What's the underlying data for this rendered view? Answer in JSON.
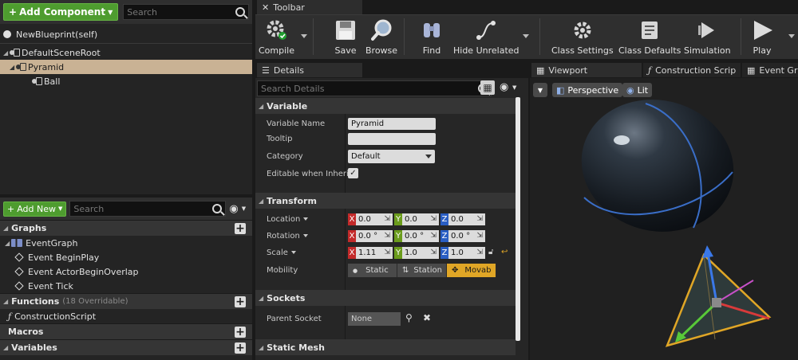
{
  "components": {
    "add_component_label": "Add Component",
    "search_placeholder": "Search",
    "self_item": "NewBlueprint(self)",
    "tree": [
      {
        "label": "DefaultSceneRoot"
      },
      {
        "label": "Pyramid"
      },
      {
        "label": "Ball"
      }
    ]
  },
  "my_blueprint": {
    "add_new_label": "Add New",
    "search_placeholder": "Search",
    "graphs_label": "Graphs",
    "event_graph_label": "EventGraph",
    "events": [
      "Event BeginPlay",
      "Event ActorBeginOverlap",
      "Event Tick"
    ],
    "functions_label": "Functions",
    "functions_sub": "(18 Overridable)",
    "construction_script_label": "ConstructionScript",
    "macros_label": "Macros",
    "variables_label": "Variables"
  },
  "toolbar": {
    "tab_label": "Toolbar",
    "buttons": {
      "compile": "Compile",
      "save": "Save",
      "browse": "Browse",
      "find": "Find",
      "hide_unrelated": "Hide Unrelated",
      "class_settings": "Class Settings",
      "class_defaults": "Class Defaults",
      "simulation": "Simulation",
      "play": "Play"
    }
  },
  "details": {
    "tab_label": "Details",
    "search_placeholder": "Search Details",
    "variable_section": "Variable",
    "variable_name_label": "Variable Name",
    "variable_name_value": "Pyramid",
    "tooltip_label": "Tooltip",
    "tooltip_value": "",
    "category_label": "Category",
    "category_value": "Default",
    "editable_label": "Editable when Inherite",
    "editable_checked": true,
    "transform_section": "Transform",
    "location_label": "Location",
    "location": {
      "x": "0.0",
      "y": "0.0",
      "z": "0.0"
    },
    "rotation_label": "Rotation",
    "rotation": {
      "x": "0.0 °",
      "y": "0.0 °",
      "z": "0.0 °"
    },
    "scale_label": "Scale",
    "scale": {
      "x": "1.11",
      "y": "1.0",
      "z": "1.0"
    },
    "mobility_label": "Mobility",
    "mobility_options": [
      "Static",
      "Station",
      "Movab"
    ],
    "mobility_selected": "Movab",
    "sockets_section": "Sockets",
    "parent_socket_label": "Parent Socket",
    "parent_socket_value": "None",
    "static_mesh_section": "Static Mesh"
  },
  "viewport": {
    "tabs": [
      "Viewport",
      "Construction Scrip",
      "Event Gra"
    ],
    "perspective_label": "Perspective",
    "lit_label": "Lit"
  },
  "colors": {
    "accent_green": "#4e9c2f",
    "selection": "#c9b294",
    "mobility_active": "#e0a626"
  }
}
